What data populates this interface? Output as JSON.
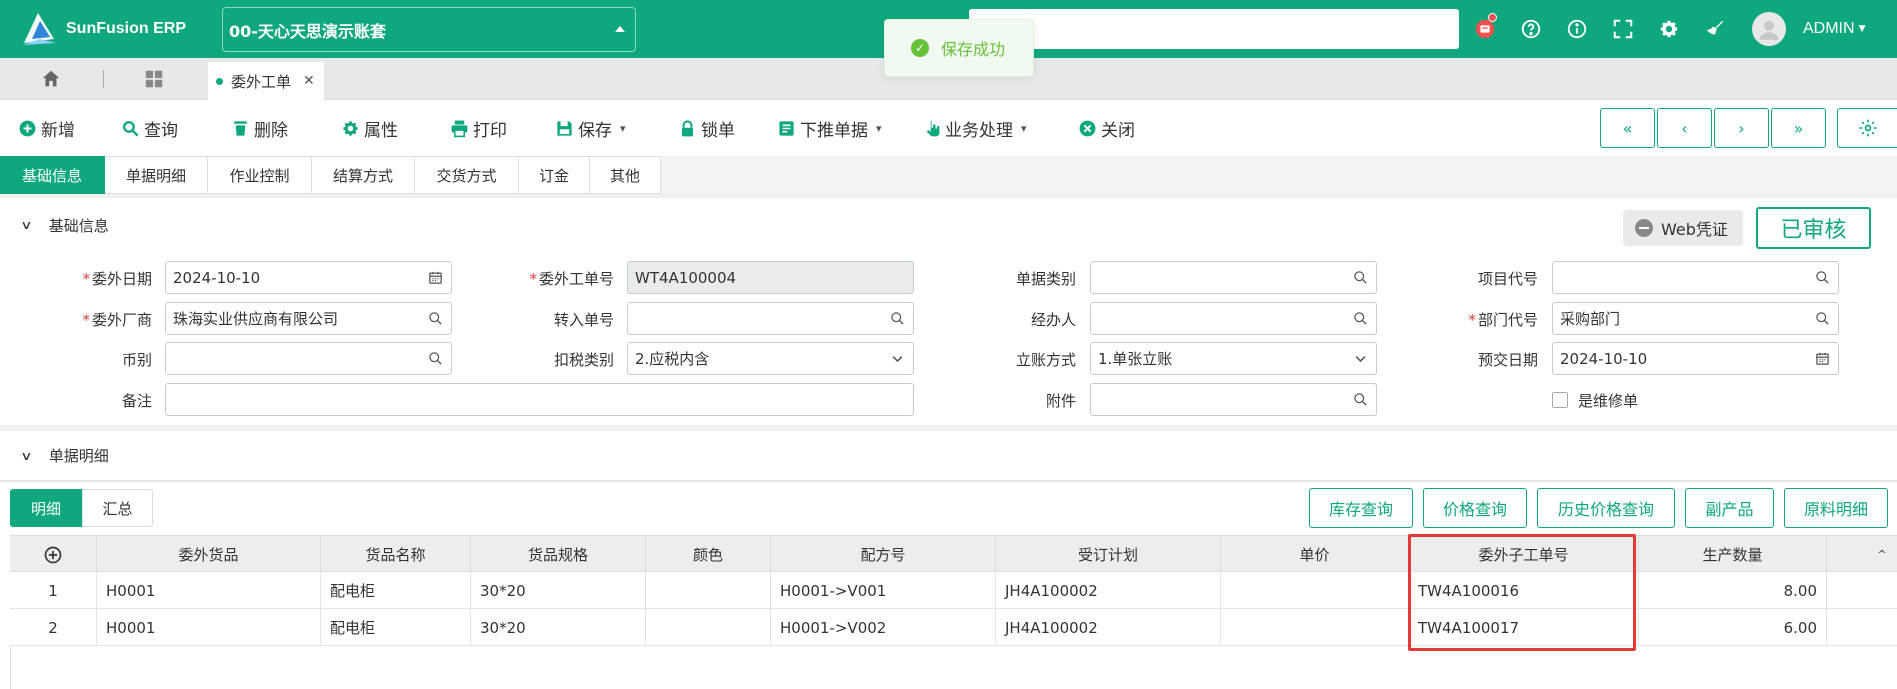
{
  "app": {
    "logo_text": "SunFusion ERP",
    "account": "00-天心天思演示账套",
    "user": "ADMIN",
    "brand_color": "#0fa77e"
  },
  "toast": {
    "text": "保存成功"
  },
  "open_tab": {
    "label": "委外工单"
  },
  "toolbar": {
    "new": "新增",
    "query": "查询",
    "delete": "删除",
    "properties": "属性",
    "print": "打印",
    "save": "保存",
    "lock": "锁单",
    "push_down": "下推单据",
    "business": "业务处理",
    "close": "关闭"
  },
  "subtabs": [
    "基础信息",
    "单据明细",
    "作业控制",
    "结算方式",
    "交货方式",
    "订金",
    "其他"
  ],
  "basic_section": {
    "title": "基础信息",
    "web_voucher": "Web凭证",
    "status": "已审核"
  },
  "form": {
    "outsource_date": {
      "label": "委外日期",
      "value": "2024-10-10"
    },
    "order_no": {
      "label": "委外工单号",
      "value": "WT4A100004"
    },
    "doc_type": {
      "label": "单据类别",
      "value": ""
    },
    "project_code": {
      "label": "项目代号",
      "value": ""
    },
    "vendor": {
      "label": "委外厂商",
      "value": "珠海实业供应商有限公司"
    },
    "transfer_no": {
      "label": "转入单号",
      "value": ""
    },
    "handler": {
      "label": "经办人",
      "value": ""
    },
    "dept_code": {
      "label": "部门代号",
      "value": "采购部门"
    },
    "currency": {
      "label": "币别",
      "value": ""
    },
    "tax_type": {
      "label": "扣税类别",
      "value": "2.应税内含"
    },
    "account_mode": {
      "label": "立账方式",
      "value": "1.单张立账"
    },
    "delivery_date": {
      "label": "预交日期",
      "value": "2024-10-10"
    },
    "remark": {
      "label": "备注",
      "value": ""
    },
    "attachment": {
      "label": "附件",
      "value": ""
    },
    "repair_order": {
      "label": "是维修单",
      "checked": false
    }
  },
  "detail_section": {
    "title": "单据明细",
    "seg_detail": "明细",
    "seg_summary": "汇总",
    "buttons": [
      "库存查询",
      "价格查询",
      "历史价格查询",
      "副产品",
      "原料明细"
    ]
  },
  "table": {
    "columns": [
      "委外货品",
      "货品名称",
      "货品规格",
      "颜色",
      "配方号",
      "受订计划",
      "单价",
      "委外子工单号",
      "生产数量"
    ],
    "rows": [
      {
        "no": "1",
        "item": "H0001",
        "name": "配电柜",
        "spec": "30*20",
        "color": "",
        "formula": "H0001->V001",
        "plan": "JH4A100002",
        "price": "",
        "sub_order": "TW4A100016",
        "qty": "8.00"
      },
      {
        "no": "2",
        "item": "H0001",
        "name": "配电柜",
        "spec": "30*20",
        "color": "",
        "formula": "H0001->V002",
        "plan": "JH4A100002",
        "price": "",
        "sub_order": "TW4A100017",
        "qty": "6.00"
      }
    ]
  }
}
